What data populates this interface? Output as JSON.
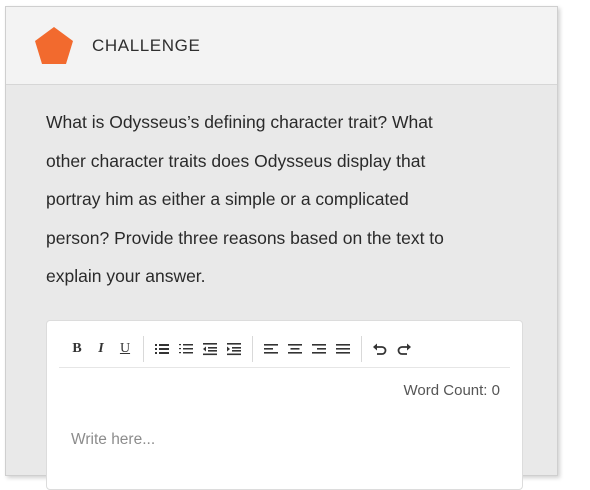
{
  "header": {
    "icon": "pentagon-icon",
    "icon_color": "#f26a2e",
    "title": "CHALLENGE"
  },
  "prompt": {
    "lines": [
      "What is Odysseus’s defining character trait? What",
      "other character traits does Odysseus display that",
      "portray him as either a simple or a complicated",
      "person? Provide three reasons based on the text to",
      "explain your answer."
    ]
  },
  "editor": {
    "toolbar": {
      "bold_label": "B",
      "italic_label": "I",
      "underline_label": "U",
      "icons": {
        "bullet_list": "bullet-list-icon",
        "numbered_list": "numbered-list-icon",
        "outdent": "outdent-icon",
        "indent": "indent-icon",
        "align_left": "align-left-icon",
        "align_center": "align-center-icon",
        "align_right": "align-right-icon",
        "justify": "justify-icon",
        "undo": "undo-icon",
        "redo": "redo-icon"
      }
    },
    "word_count_label": "Word Count: 0",
    "placeholder": "Write here..."
  }
}
